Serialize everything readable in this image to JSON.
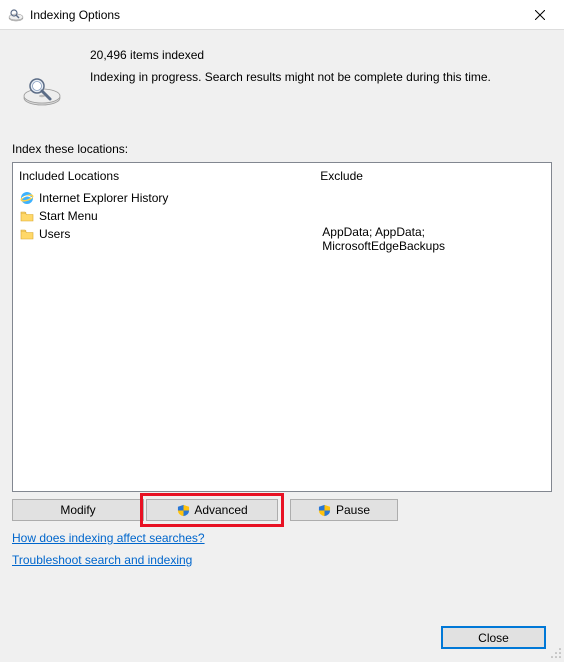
{
  "window": {
    "title": "Indexing Options",
    "close": "🞩"
  },
  "status": {
    "items_indexed": "20,496 items indexed",
    "message": "Indexing in progress. Search results might not be complete during this time."
  },
  "locations_label": "Index these locations:",
  "list": {
    "included_header": "Included Locations",
    "exclude_header": "Exclude",
    "rows": [
      {
        "icon": "ie",
        "label": "Internet Explorer History",
        "exclude": ""
      },
      {
        "icon": "folder",
        "label": "Start Menu",
        "exclude": ""
      },
      {
        "icon": "folder",
        "label": "Users",
        "exclude": "AppData; AppData; MicrosoftEdgeBackups"
      }
    ]
  },
  "buttons": {
    "modify": "Modify",
    "advanced": "Advanced",
    "pause": "Pause",
    "close": "Close"
  },
  "links": {
    "how": "How does indexing affect searches?",
    "troubleshoot": "Troubleshoot search and indexing"
  }
}
